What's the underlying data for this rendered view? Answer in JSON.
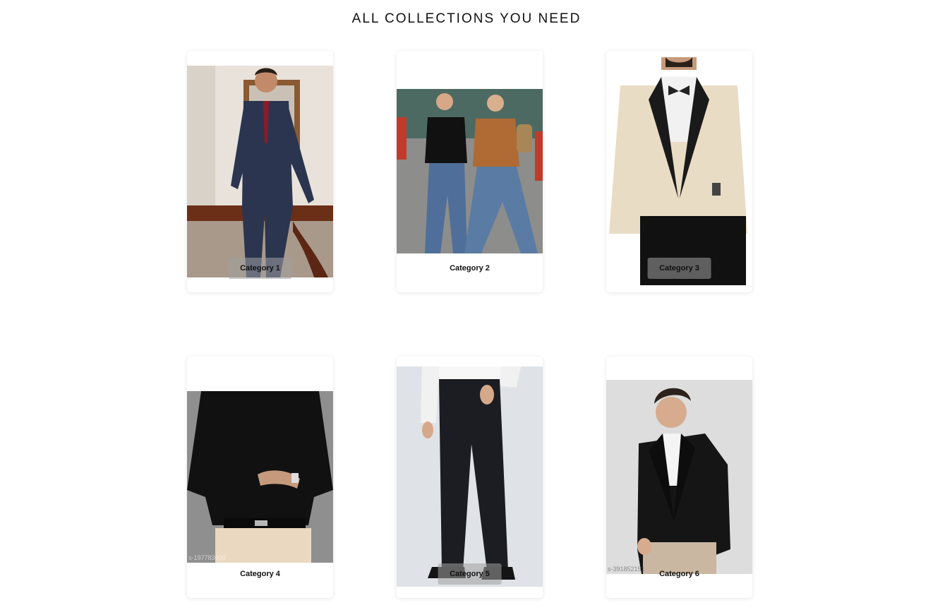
{
  "section": {
    "title": "ALL COLLECTIONS YOU NEED"
  },
  "categories": [
    {
      "label": "Category 1",
      "photo": "man-in-navy-three-piece-suit",
      "photo_color": "#2b3550"
    },
    {
      "label": "Category 2",
      "photo": "women-in-jeans-street-style",
      "photo_color": "#4f6f9a"
    },
    {
      "label": "Category 3",
      "photo": "cream-tuxedo-with-bow-tie",
      "photo_color": "#e9dcc4"
    },
    {
      "label": "Category 4",
      "photo": "black-shirt-beige-trousers",
      "photo_color": "#111111",
      "watermark": "s-197783600"
    },
    {
      "label": "Category 5",
      "photo": "black-formal-trousers",
      "photo_color": "#1b1d22"
    },
    {
      "label": "Category 6",
      "photo": "man-in-black-blazer",
      "photo_color": "#151515",
      "watermark": "s-391852151"
    }
  ]
}
